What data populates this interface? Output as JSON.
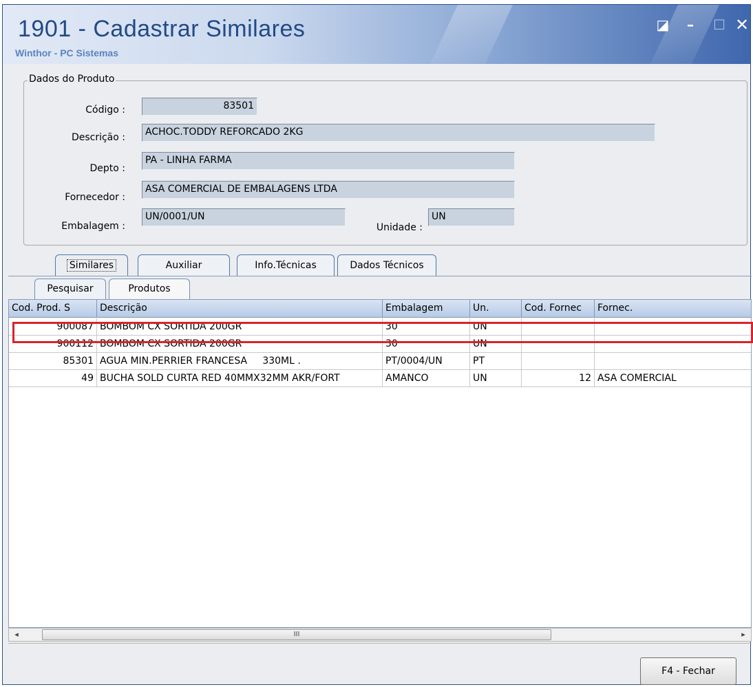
{
  "window": {
    "title": "1901 - Cadastrar Similares",
    "subtitle": "Winthor - PC Sistemas",
    "controls": {
      "restore": "◪",
      "minimize": "–",
      "maximize": "☐",
      "close": "✕"
    }
  },
  "product": {
    "group_title": "Dados do Produto",
    "codigo_label": "Código :",
    "codigo_value": "83501",
    "descricao_label": "Descrição :",
    "descricao_value": "ACHOC.TODDY REFORCADO 2KG",
    "depto_label": "Depto :",
    "depto_value": "PA - LINHA FARMA",
    "fornecedor_label": "Fornecedor :",
    "fornecedor_value": "ASA COMERCIAL DE EMBALAGENS LTDA",
    "embalagem_label": "Embalagem :",
    "embalagem_value": "UN/0001/UN",
    "unidade_label": "Unidade :",
    "unidade_value": "UN"
  },
  "tabs": [
    "Similares",
    "Auxiliar",
    "Info.Técnicas",
    "Dados Técnicos"
  ],
  "subtabs": [
    "Pesquisar",
    "Produtos"
  ],
  "grid": {
    "columns": [
      "Cod. Prod. S",
      "Descrição",
      "Embalagem",
      "Un.",
      "Cod. Fornec",
      "Fornec."
    ],
    "rows": [
      [
        "900087",
        "BOMBOM CX SORTIDA 200GR",
        "30",
        "UN",
        "",
        ""
      ],
      [
        "900112",
        "BOMBOM CX SORTIDA 200GR",
        "30",
        "UN",
        "",
        ""
      ],
      [
        "85301",
        "AGUA MIN.PERRIER FRANCESA     330ML .",
        "PT/0004/UN",
        "PT",
        "",
        ""
      ],
      [
        "49",
        "BUCHA SOLD CURTA RED 40MMX32MM AKR/FORT",
        "AMANCO",
        "UN",
        "12",
        "ASA COMERCIAL"
      ]
    ]
  },
  "scrollbar": {
    "left": "◂",
    "right": "▸",
    "thumb": "III"
  },
  "footer": {
    "close_button": "F4 - Fechar"
  },
  "colors": {
    "highlight": "#d8232a",
    "title": "#224a86"
  }
}
